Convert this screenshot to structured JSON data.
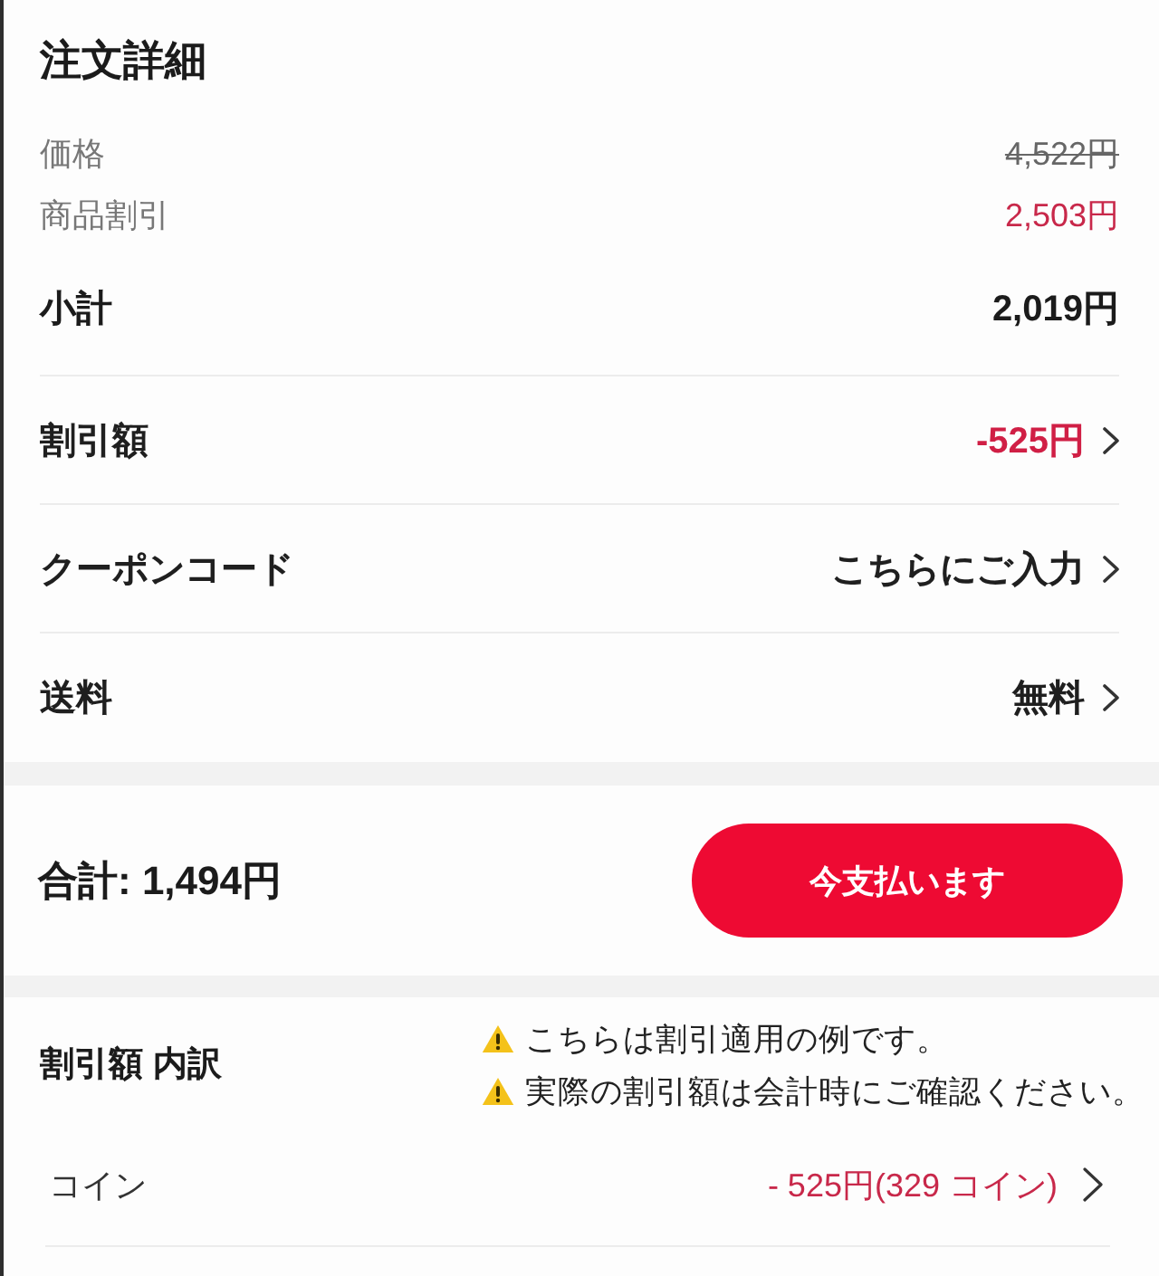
{
  "title": "注文詳細",
  "price_rows": [
    {
      "label": "価格",
      "value": "4,522円",
      "kind": "original_price"
    },
    {
      "label": "商品割引",
      "value": "2,503円",
      "kind": "discount"
    }
  ],
  "subtotal": {
    "label": "小計",
    "value": "2,019円"
  },
  "rows": [
    {
      "label": "割引額",
      "value": "-525円",
      "kind": "discount"
    },
    {
      "label": "クーポンコード",
      "value": "こちらにご入力",
      "kind": "normal"
    },
    {
      "label": "送料",
      "value": "無料",
      "kind": "normal"
    }
  ],
  "checkout": {
    "total": "合計: 1,494円",
    "button": "今支払います"
  },
  "breakdown": {
    "title": "割引額 内訳",
    "notes": [
      "こちらは割引適用の例です。",
      "実際の割引額は会計時にご確認ください。"
    ],
    "items": [
      {
        "label": "コイン",
        "value": "- 525円(329 コイン)"
      }
    ]
  }
}
